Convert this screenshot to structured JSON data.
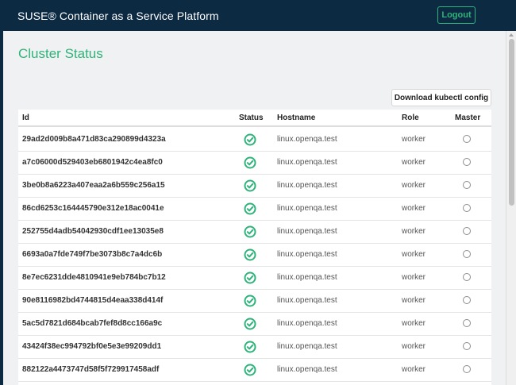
{
  "app": {
    "title": "SUSE® Container as a Service Platform",
    "logout_label": "Logout"
  },
  "page": {
    "title": "Cluster Status",
    "download_label": "Download kubectl config"
  },
  "colors": {
    "accent": "#2fb37a",
    "navbar": "#0d2a43"
  },
  "table": {
    "headers": {
      "id": "Id",
      "status": "Status",
      "hostname": "Hostname",
      "role": "Role",
      "master": "Master"
    },
    "rows": [
      {
        "id": "29ad2d009b8a471d83ca290899d4323a",
        "status": "check-circle-icon",
        "hostname": "linux.openqa.test",
        "role": "worker",
        "master": false
      },
      {
        "id": "a7c06000d529403eb6801942c4ea8fc0",
        "status": "check-circle-icon",
        "hostname": "linux.openqa.test",
        "role": "worker",
        "master": false
      },
      {
        "id": "3be0b8a6223a407eaa2a6b559c256a15",
        "status": "check-circle-icon",
        "hostname": "linux.openqa.test",
        "role": "worker",
        "master": false
      },
      {
        "id": "86cd6253c164445790e312e18ac0041e",
        "status": "check-circle-icon",
        "hostname": "linux.openqa.test",
        "role": "worker",
        "master": false
      },
      {
        "id": "252755d4adb54042930cdf1ee13035e8",
        "status": "check-circle-icon",
        "hostname": "linux.openqa.test",
        "role": "worker",
        "master": false
      },
      {
        "id": "6693a0a7fde749f7be3073b8c7a4dc6b",
        "status": "check-circle-icon",
        "hostname": "linux.openqa.test",
        "role": "worker",
        "master": false
      },
      {
        "id": "8e7ec6231dde4810941e9eb784bc7b12",
        "status": "check-circle-icon",
        "hostname": "linux.openqa.test",
        "role": "worker",
        "master": false
      },
      {
        "id": "90e8116982bd4744815d4eaa338d414f",
        "status": "check-circle-icon",
        "hostname": "linux.openqa.test",
        "role": "worker",
        "master": false
      },
      {
        "id": "5ac5d7821d684bcab7fef8d8cc166a9c",
        "status": "check-circle-icon",
        "hostname": "linux.openqa.test",
        "role": "worker",
        "master": false
      },
      {
        "id": "43424f38ec994792bf0e5e3e99209dd1",
        "status": "check-circle-icon",
        "hostname": "linux.openqa.test",
        "role": "worker",
        "master": false
      },
      {
        "id": "882122a4473747d58f5f729917458adf",
        "status": "check-circle-icon",
        "hostname": "linux.openqa.test",
        "role": "worker",
        "master": false
      }
    ]
  }
}
